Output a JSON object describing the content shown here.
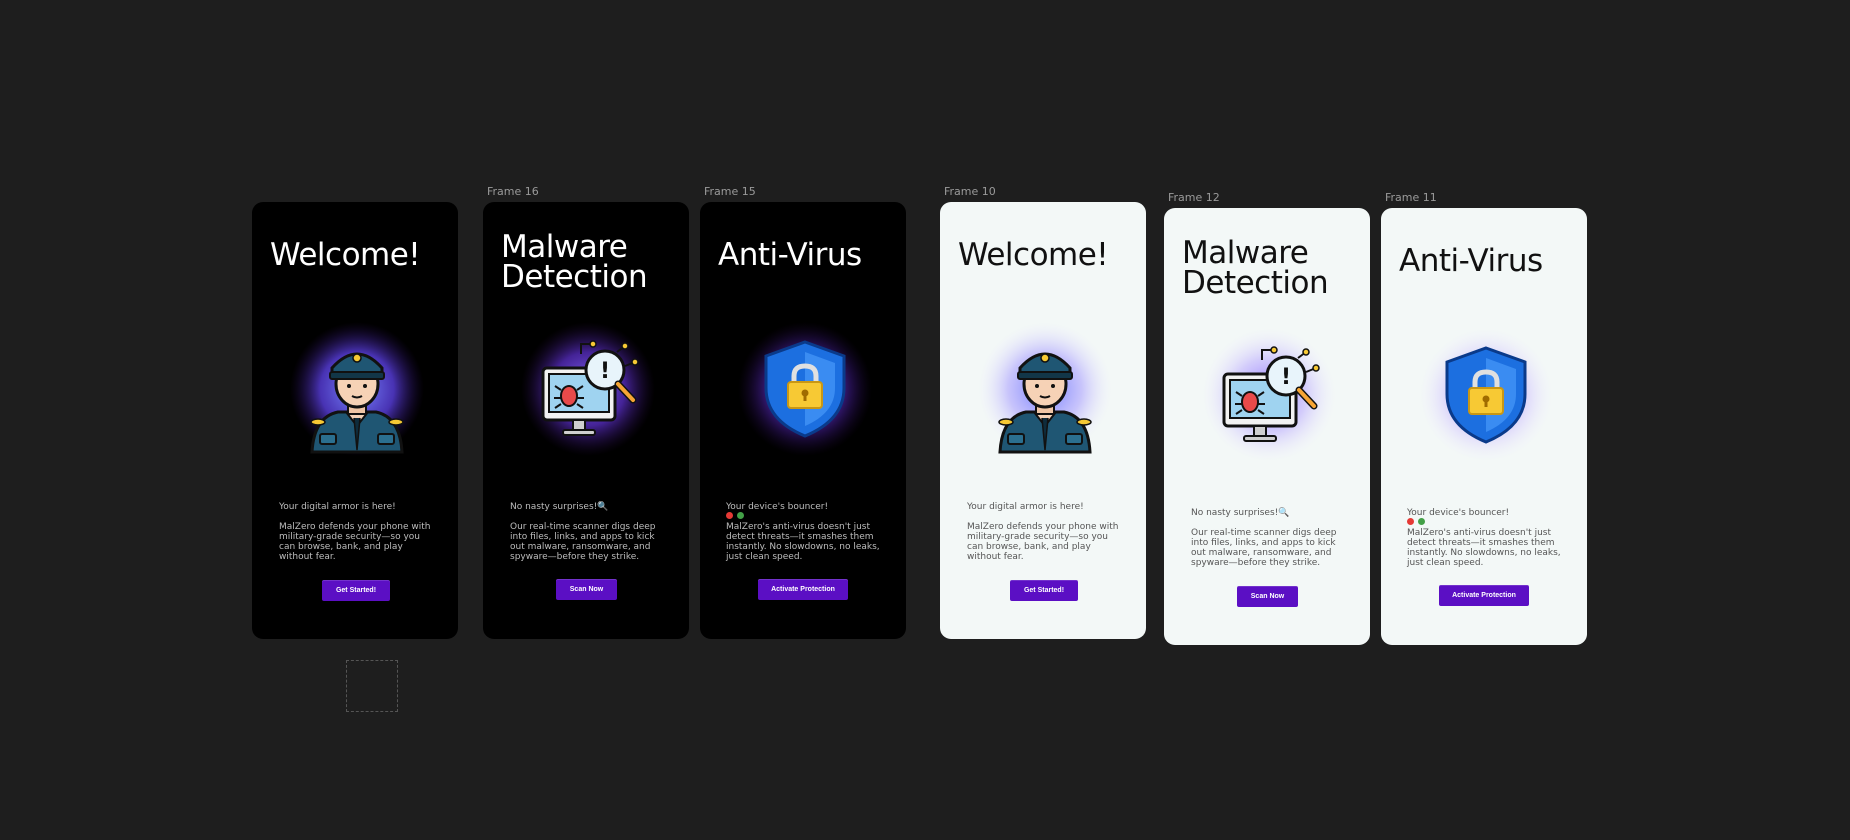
{
  "canvas": {
    "placeholder_label": ""
  },
  "frames": [
    {
      "label": "",
      "theme": "dark",
      "title": "Welcome!",
      "icon": "security-guard-icon",
      "tagline": "Your digital armor is here!",
      "emoji": [],
      "body": "MalZero defends your phone with military-grade security—so you can browse, bank, and play without fear.",
      "button": "Get Started!"
    },
    {
      "label": "Frame 16",
      "theme": "dark",
      "title": "Malware\nDetection",
      "icon": "malware-scan-icon",
      "tagline": "No nasty surprises!🔍",
      "emoji": [],
      "body": "Our real-time scanner digs deep into files, links, and apps to kick out malware, ransomware, and spyware—before they strike.",
      "button": "Scan Now"
    },
    {
      "label": "Frame 15",
      "theme": "dark",
      "title": "Anti-Virus",
      "icon": "shield-lock-icon",
      "tagline": "Your device's bouncer!",
      "emoji": [
        "🚫",
        "🟢"
      ],
      "body": "MalZero's anti-virus doesn't just detect threats—it smashes them instantly. No slowdowns, no leaks, just clean speed.",
      "button": "Activate Protection"
    },
    {
      "label": "Frame 10",
      "theme": "light",
      "title": "Welcome!",
      "icon": "security-guard-icon",
      "tagline": "Your digital armor is here!",
      "emoji": [],
      "body": "MalZero defends your phone with military-grade security—so you can browse, bank, and play without fear.",
      "button": "Get Started!"
    },
    {
      "label": "Frame 12",
      "theme": "light",
      "title": "Malware\nDetection",
      "icon": "malware-scan-icon",
      "tagline": "No nasty surprises!🔍",
      "emoji": [],
      "body": "Our real-time scanner digs deep into files, links, and apps to kick out malware, ransomware, and spyware—before they strike.",
      "button": "Scan Now"
    },
    {
      "label": "Frame 11",
      "theme": "light",
      "title": "Anti-Virus",
      "icon": "shield-lock-icon",
      "tagline": "Your device's bouncer!",
      "emoji": [
        "🚫",
        "🟢"
      ],
      "body": "MalZero's anti-virus doesn't just detect threats—it smashes them instantly. No slowdowns, no leaks, just clean speed.",
      "button": "Activate Protection"
    }
  ],
  "colors": {
    "canvas_bg": "#1e1e1e",
    "dark_frame_bg": "#000000",
    "light_frame_bg": "#f3f8f7",
    "button_bg": "#5b0fc4",
    "glow": "#6b4dff",
    "shield_blue": "#1c6fe0",
    "lock_yellow": "#f7c934"
  }
}
